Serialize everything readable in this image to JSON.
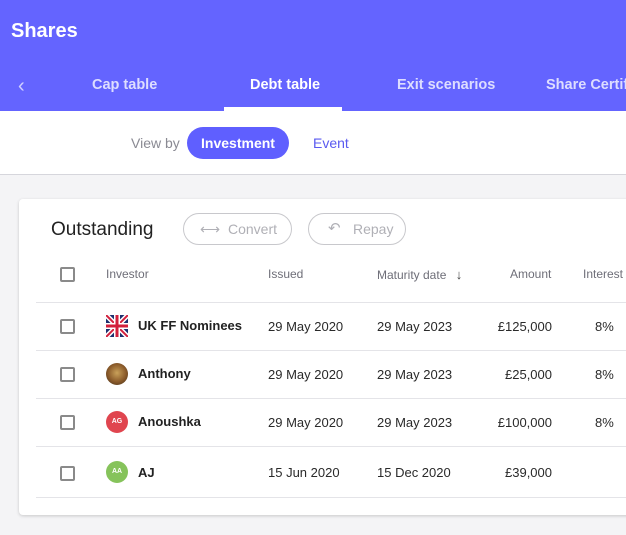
{
  "app": {
    "title": "Shares"
  },
  "tabs": [
    {
      "label": "Cap table"
    },
    {
      "label": "Debt table"
    },
    {
      "label": "Exit scenarios"
    },
    {
      "label": "Share Certifi"
    }
  ],
  "view_by": {
    "label": "View by",
    "options": [
      "Investment",
      "Event"
    ],
    "selected": "Investment"
  },
  "outstanding": {
    "title": "Outstanding",
    "convert_label": "Convert",
    "repay_label": "Repay",
    "columns": {
      "investor": "Investor",
      "issued": "Issued",
      "maturity": "Maturity date",
      "amount": "Amount",
      "interest": "Interest"
    },
    "rows": [
      {
        "avatar": "uk-flag",
        "initials": "",
        "investor": "UK FF Nominees",
        "issued": "29 May 2020",
        "maturity": "29 May 2023",
        "amount": "£125,000",
        "interest": "8%"
      },
      {
        "avatar": "photo",
        "initials": "",
        "investor": "Anthony",
        "issued": "29 May 2020",
        "maturity": "29 May 2023",
        "amount": "£25,000",
        "interest": "8%"
      },
      {
        "avatar": "initials",
        "initials": "AG",
        "investor": "Anoushka",
        "issued": "29 May 2020",
        "maturity": "29 May 2023",
        "amount": "£100,000",
        "interest": "8%"
      },
      {
        "avatar": "initials",
        "initials": "AA",
        "investor": "AJ",
        "issued": "15 Jun 2020",
        "maturity": "15 Dec 2020",
        "amount": "£39,000",
        "interest": ""
      }
    ]
  },
  "colors": {
    "header": "#6464ff",
    "accent": "#5f5fff",
    "avatar_ag": "#e0454f",
    "avatar_aa": "#86c35b"
  }
}
